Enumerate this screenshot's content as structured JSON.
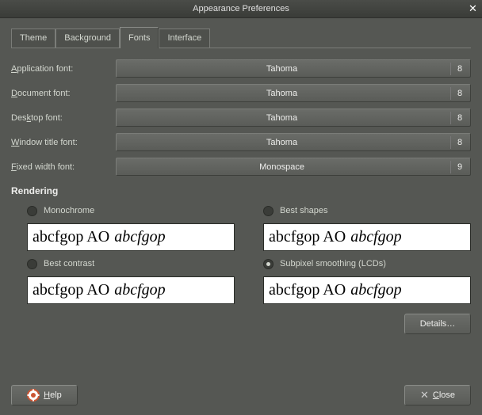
{
  "window": {
    "title": "Appearance Preferences"
  },
  "tabs": [
    {
      "label": "Theme",
      "active": false
    },
    {
      "label": "Background",
      "active": false
    },
    {
      "label": "Fonts",
      "active": true
    },
    {
      "label": "Interface",
      "active": false
    }
  ],
  "fonts": {
    "application": {
      "label_prefix": "",
      "label_mn": "A",
      "label_rest": "pplication font:",
      "name": "Tahoma",
      "size": "8"
    },
    "document": {
      "label_prefix": "",
      "label_mn": "D",
      "label_rest": "ocument font:",
      "name": "Tahoma",
      "size": "8"
    },
    "desktop": {
      "label_prefix": "Des",
      "label_mn": "k",
      "label_rest": "top font:",
      "name": "Tahoma",
      "size": "8"
    },
    "windowtitle": {
      "label_prefix": "",
      "label_mn": "W",
      "label_rest": "indow title font:",
      "name": "Tahoma",
      "size": "8"
    },
    "fixedwidth": {
      "label_prefix": "",
      "label_mn": "F",
      "label_rest": "ixed width font:",
      "name": "Monospace",
      "size": "9"
    }
  },
  "rendering": {
    "heading": "Rendering",
    "options": {
      "monochrome": {
        "label": "Monochrome",
        "selected": false
      },
      "best_shapes": {
        "label": "Best shapes",
        "selected": false
      },
      "best_contrast": {
        "label": "Best contrast",
        "selected": false
      },
      "subpixel": {
        "label": "Subpixel smoothing (LCDs)",
        "selected": true
      }
    },
    "sample_normal": "abcfgop AO",
    "sample_italic": "abcfgop"
  },
  "buttons": {
    "details": "Details…",
    "help": "Help",
    "close": "Close"
  }
}
